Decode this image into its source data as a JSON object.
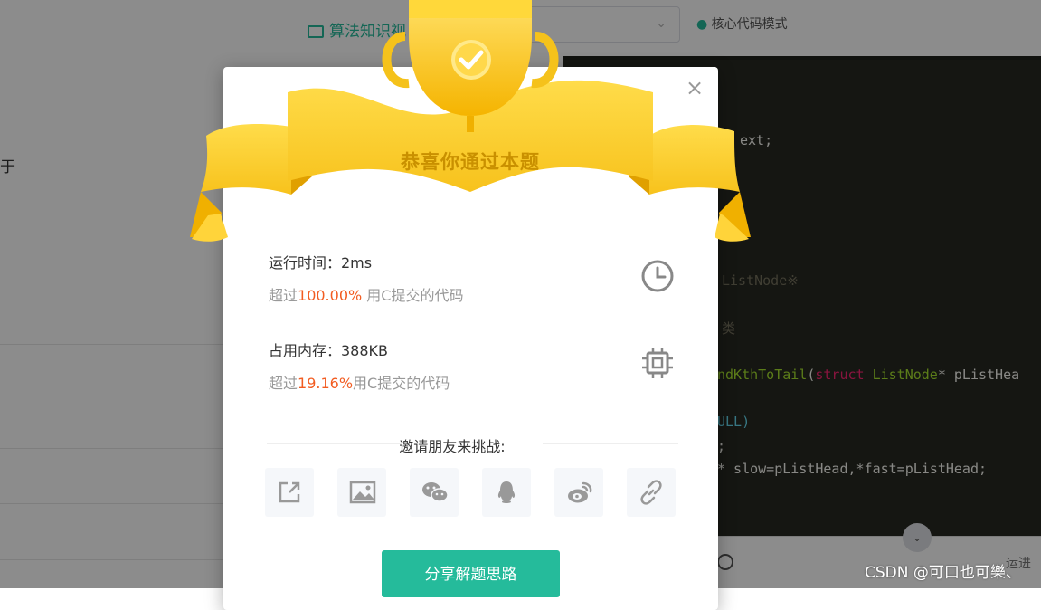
{
  "background": {
    "video_link": "算法知识视",
    "mode_text": "核心代码模式",
    "side_char": "于",
    "run_text": "运进",
    "code_lines": [
      {
        "text": "ext;",
        "cls": ""
      },
      {
        "text": "ListNode※",
        "cls": "dim"
      },
      {
        "text": "类",
        "cls": "dim"
      },
      {
        "text": "ndKthToTail(struct ListNode* pListHea",
        "cls": "fn"
      },
      {
        "text": "ULL)",
        "cls": "ty"
      },
      {
        "text": ";",
        "cls": ""
      },
      {
        "text": "* slow=pListHead,*fast=pListHead;",
        "cls": ""
      }
    ]
  },
  "modal": {
    "title": "恭喜你通过本题",
    "close_label": "×",
    "runtime": {
      "label": "运行时间：2ms",
      "prefix": "超过",
      "percent": "100.00%",
      "suffix": " 用C提交的代码"
    },
    "memory": {
      "label": "占用内存：388KB",
      "prefix": "超过",
      "percent": "19.16%",
      "suffix": "用C提交的代码"
    },
    "invite_text": "邀请朋友来挑战:",
    "share_icons": [
      "share-external-icon",
      "image-icon",
      "wechat-icon",
      "qq-icon",
      "weibo-icon",
      "link-icon"
    ],
    "primary_button": "分享解题思路"
  },
  "watermark": "CSDN @可口也可樂、",
  "colors": {
    "accent": "#25bb9b",
    "highlight": "#f25c21",
    "gold": "#f5c21b"
  }
}
